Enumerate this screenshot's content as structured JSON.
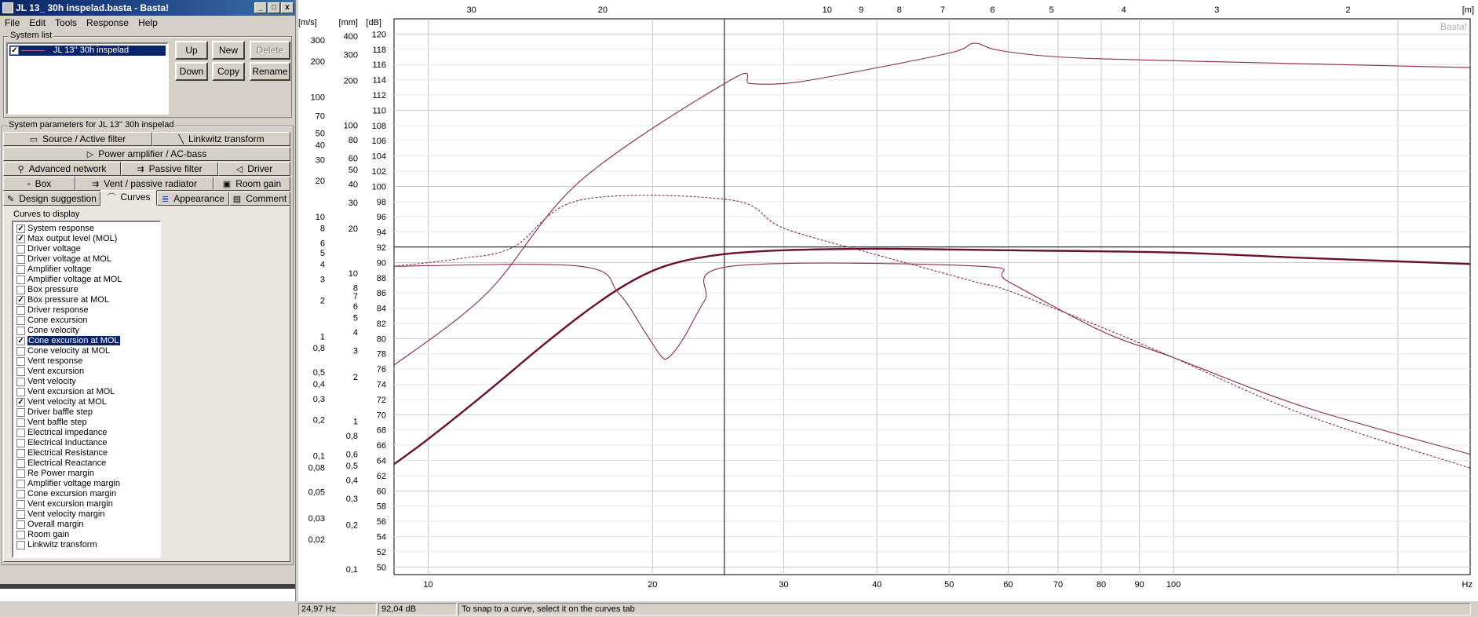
{
  "window": {
    "title": "JL 13_ 30h inspelad.basta - Basta!",
    "buttons": [
      "_",
      "□",
      "x"
    ]
  },
  "menu": [
    "File",
    "Edit",
    "Tools",
    "Response",
    "Help"
  ],
  "system_list": {
    "label": "System list",
    "items": [
      {
        "name": "JL 13'' 30h inspelad",
        "checked": true,
        "selected": true
      }
    ],
    "buttons": {
      "up": "Up",
      "new": "New",
      "delete": "Delete",
      "down": "Down",
      "copy": "Copy",
      "rename": "Rename"
    }
  },
  "system_params": {
    "label": "System parameters for JL 13'' 30h inspelad",
    "tabs_row1": [
      {
        "label": "Source / Active filter",
        "icon": "source-icon"
      },
      {
        "label": "Linkwitz transform",
        "icon": "linkwitz-icon"
      }
    ],
    "tabs_row2": [
      {
        "label": "Power amplifier / AC-bass",
        "icon": "amplifier-icon"
      }
    ],
    "tabs_row3": [
      {
        "label": "Advanced network",
        "icon": "network-icon"
      },
      {
        "label": "Passive filter",
        "icon": "passive-filter-icon"
      },
      {
        "label": "Driver",
        "icon": "driver-icon"
      }
    ],
    "tabs_row4": [
      {
        "label": "Box",
        "icon": "box-icon"
      },
      {
        "label": "Vent / passive radiator",
        "icon": "vent-icon"
      },
      {
        "label": "Room gain",
        "icon": "room-gain-icon"
      }
    ],
    "tabs_row5": [
      {
        "label": "Design suggestion",
        "icon": "pencil-icon"
      },
      {
        "label": "Curves",
        "icon": "curve-icon",
        "active": true
      },
      {
        "label": "Appearance",
        "icon": "appearance-icon"
      },
      {
        "label": "Comment",
        "icon": "comment-icon"
      }
    ]
  },
  "curves": {
    "label": "Curves to display",
    "items": [
      {
        "label": "System response",
        "checked": true
      },
      {
        "label": "Max output level (MOL)",
        "checked": true
      },
      {
        "label": "Driver voltage",
        "checked": false
      },
      {
        "label": "Driver voltage at MOL",
        "checked": false
      },
      {
        "label": "Amplifier voltage",
        "checked": false
      },
      {
        "label": "Amplifier voltage at MOL",
        "checked": false
      },
      {
        "label": "Box pressure",
        "checked": false
      },
      {
        "label": "Box pressure at MOL",
        "checked": true
      },
      {
        "label": "Driver response",
        "checked": false
      },
      {
        "label": "Cone excursion",
        "checked": false
      },
      {
        "label": "Cone velocity",
        "checked": false
      },
      {
        "label": "Cone excursion at MOL",
        "checked": true,
        "selected": true
      },
      {
        "label": "Cone velocity at MOL",
        "checked": false
      },
      {
        "label": "Vent response",
        "checked": false
      },
      {
        "label": "Vent excursion",
        "checked": false
      },
      {
        "label": "Vent velocity",
        "checked": false
      },
      {
        "label": "Vent excursion at MOL",
        "checked": false
      },
      {
        "label": "Vent velocity at MOL",
        "checked": true
      },
      {
        "label": "Driver baffle step",
        "checked": false
      },
      {
        "label": "Vent baffle step",
        "checked": false
      },
      {
        "label": "Electrical impedance",
        "checked": false
      },
      {
        "label": "Electrical Inductance",
        "checked": false
      },
      {
        "label": "Electrical Resistance",
        "checked": false
      },
      {
        "label": "Electrical Reactance",
        "checked": false
      },
      {
        "label": "Re Power margin",
        "checked": false
      },
      {
        "label": "Amplifier voltage margin",
        "checked": false
      },
      {
        "label": "Cone excursion margin",
        "checked": false
      },
      {
        "label": "Vent excursion margin",
        "checked": false
      },
      {
        "label": "Vent velocity margin",
        "checked": false
      },
      {
        "label": "Overall margin",
        "checked": false
      },
      {
        "label": "Room gain",
        "checked": false
      },
      {
        "label": "Linkwitz transform",
        "checked": false
      }
    ]
  },
  "status": {
    "freq": "24,97 Hz",
    "level": "92,04 dB",
    "hint": "To snap to a curve, select it on the curves tab"
  },
  "colors": {
    "curve": "#8b2a4a",
    "curve_dark": "#6a0f2e",
    "grid": "#c8c8c8",
    "grid_minor": "#e6e6e6"
  },
  "chart_data": {
    "type": "line",
    "watermark": "Basta!",
    "x_axis": {
      "label": "Hz",
      "scale": "log",
      "range": [
        9,
        250
      ],
      "ticks": [
        "10",
        "20",
        "30",
        "40",
        "50",
        "60",
        "70",
        "80",
        "90",
        "100"
      ]
    },
    "top_axis": {
      "label": "[m]",
      "ticks": [
        "30",
        "20",
        "10",
        "9",
        "8",
        "7",
        "6",
        "5",
        "4",
        "3",
        "2"
      ]
    },
    "axes": {
      "ms": {
        "label": "[m/s]",
        "ticks": [
          "300",
          "200",
          "100",
          "70",
          "50",
          "40",
          "30",
          "20",
          "10",
          "8",
          "6",
          "5",
          "4",
          "3",
          "2",
          "1",
          "0,8",
          "0,5",
          "0,4",
          "0,3",
          "0,2",
          "0,1",
          "0,08",
          "0,05",
          "0,03",
          "0,02"
        ]
      },
      "mm": {
        "label": "[mm]",
        "ticks": [
          "400",
          "300",
          "200",
          "100",
          "80",
          "60",
          "50",
          "40",
          "30",
          "20",
          "10",
          "8",
          "7",
          "6",
          "5",
          "4",
          "3",
          "2",
          "1",
          "0,8",
          "0,6",
          "0,5",
          "0,4",
          "0,3",
          "0,2",
          "0,1"
        ]
      },
      "db": {
        "label": "[dB]",
        "range": [
          49,
          122
        ],
        "ticks": [
          "120",
          "118",
          "116",
          "114",
          "112",
          "110",
          "108",
          "106",
          "104",
          "102",
          "100",
          "98",
          "96",
          "94",
          "92",
          "90",
          "88",
          "86",
          "84",
          "82",
          "80",
          "78",
          "76",
          "74",
          "72",
          "70",
          "68",
          "66",
          "64",
          "62",
          "60",
          "58",
          "56",
          "54",
          "52",
          "50"
        ]
      }
    },
    "cursor": {
      "x_hz": 24.97,
      "y_db": 92.04
    },
    "series": [
      {
        "style": "thick",
        "points": [
          [
            9,
            63.5
          ],
          [
            10,
            66.8
          ],
          [
            12,
            73
          ],
          [
            14,
            78.5
          ],
          [
            16,
            83
          ],
          [
            18,
            86.5
          ],
          [
            20,
            88.9
          ],
          [
            22,
            90.2
          ],
          [
            25,
            91.1
          ],
          [
            30,
            91.6
          ],
          [
            40,
            91.8
          ],
          [
            60,
            91.6
          ],
          [
            100,
            91.3
          ],
          [
            150,
            90.6
          ],
          [
            250,
            89.8
          ]
        ]
      },
      {
        "style": "thin",
        "points": [
          [
            9,
            89.5
          ],
          [
            16,
            89.5
          ],
          [
            18,
            86
          ],
          [
            19.5,
            81
          ],
          [
            20.5,
            77.8
          ],
          [
            21,
            77.5
          ],
          [
            22,
            80
          ],
          [
            23.5,
            85
          ],
          [
            25.5,
            89.5
          ],
          [
            55,
            89.5
          ],
          [
            60,
            87.5
          ],
          [
            80,
            81
          ],
          [
            100,
            77.5
          ],
          [
            150,
            71
          ],
          [
            250,
            64.8
          ]
        ]
      },
      {
        "style": "thin",
        "points": [
          [
            9,
            76.5
          ],
          [
            12,
            86
          ],
          [
            16,
            100.7
          ],
          [
            25.5,
            114
          ],
          [
            27,
            113.5
          ],
          [
            30,
            113.5
          ],
          [
            35,
            114.5
          ],
          [
            50,
            117.5
          ],
          [
            54,
            118.8
          ],
          [
            58,
            117.9
          ],
          [
            70,
            117
          ],
          [
            100,
            116.5
          ],
          [
            250,
            115.6
          ]
        ]
      },
      {
        "style": "dashed",
        "points": [
          [
            9,
            89.5
          ],
          [
            11,
            90.5
          ],
          [
            13,
            92
          ],
          [
            16,
            98.2
          ],
          [
            25.5,
            98.2
          ],
          [
            30,
            94.5
          ],
          [
            40,
            91
          ],
          [
            54,
            87.5
          ],
          [
            60,
            86.3
          ],
          [
            80,
            81.5
          ],
          [
            100,
            77.5
          ],
          [
            150,
            70
          ],
          [
            250,
            63
          ]
        ]
      }
    ]
  }
}
